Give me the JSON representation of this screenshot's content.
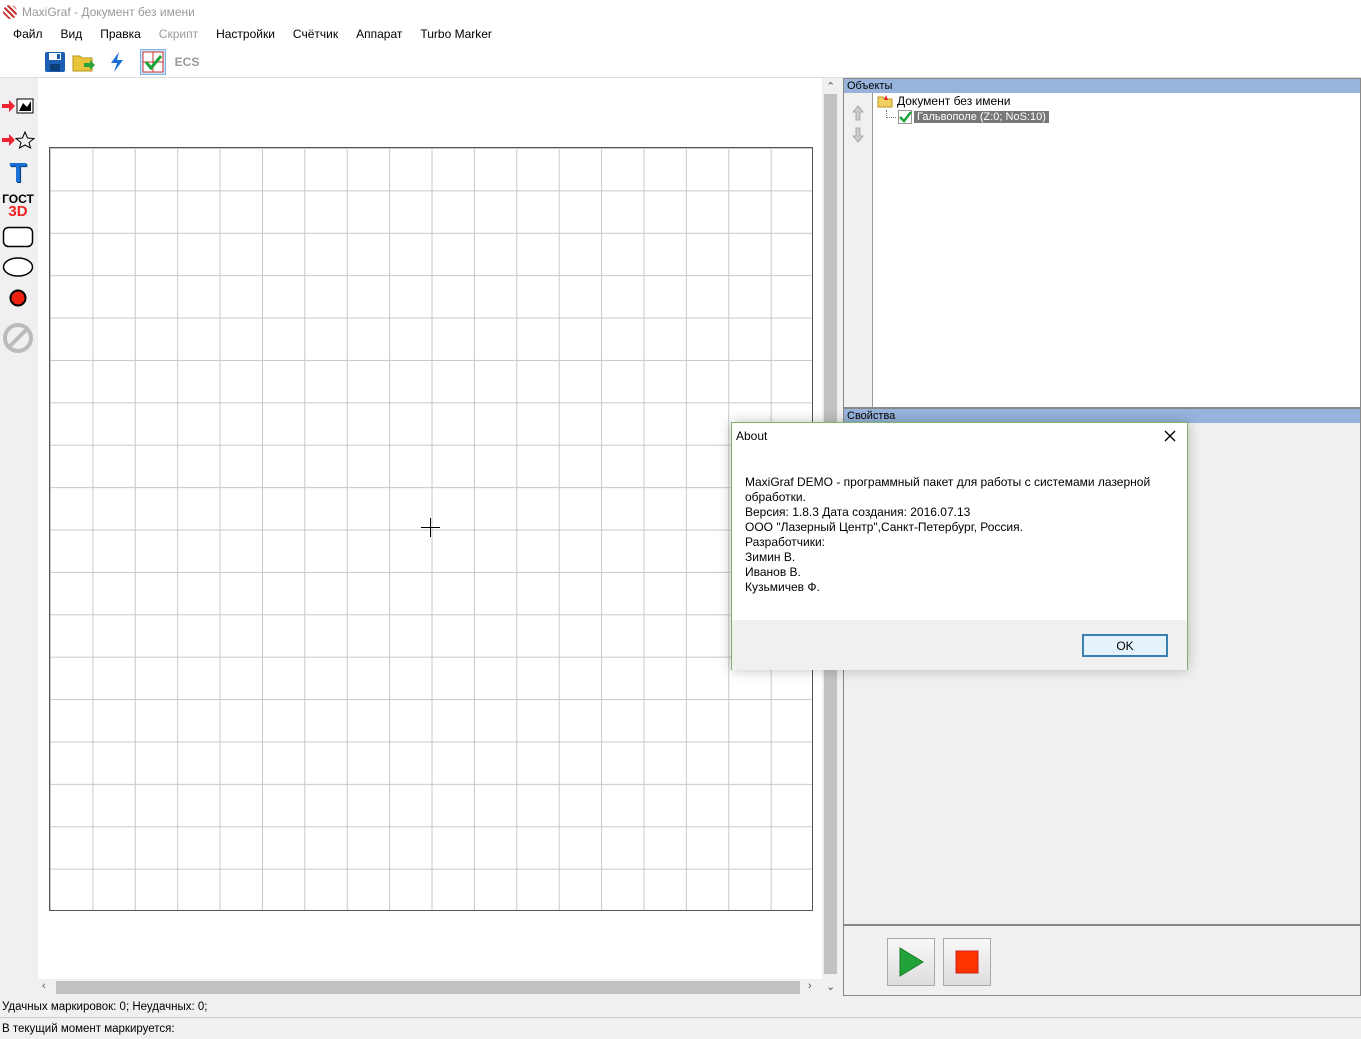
{
  "window": {
    "title": "MaxiGraf - Документ без имени"
  },
  "menu": [
    {
      "label": "Файл",
      "enabled": true
    },
    {
      "label": "Вид",
      "enabled": true
    },
    {
      "label": "Правка",
      "enabled": true
    },
    {
      "label": "Скрипт",
      "enabled": false
    },
    {
      "label": "Настройки",
      "enabled": true
    },
    {
      "label": "Счётчик",
      "enabled": true
    },
    {
      "label": "Аппарат",
      "enabled": true
    },
    {
      "label": "Turbo Marker",
      "enabled": true
    }
  ],
  "toolbar": {
    "icons": [
      "save-icon",
      "open-folder-icon",
      "lightning-icon",
      "checkbox-grid-icon",
      "ecs-icon"
    ],
    "ecs_label": "ECS"
  },
  "left_tools": {
    "gost_text": "ГОСТ",
    "gost_3d": "3D",
    "text_tool": "T"
  },
  "objects_panel": {
    "header": "Объекты",
    "root": "Документ без имени",
    "child": "Гальвополе (Z:0; NoS:10)"
  },
  "properties_panel": {
    "header": "Свойства"
  },
  "dialog": {
    "title": "About",
    "lines": [
      "MaxiGraf DEMO - программный пакет для работы с системами лазерной обработки.",
      "Версия: 1.8.3 Дата создания: 2016.07.13",
      "ООО \"Лазерный Центр\",Санкт-Петербург, Россия.",
      "Разработчики:",
      "Зимин В.",
      "Иванов В.",
      "Кузьмичев Ф."
    ],
    "ok_label": "OK"
  },
  "status": {
    "line1": "Удачных маркировок: 0; Неудачных: 0;",
    "line2": "В текущий момент маркируется:"
  },
  "colors": {
    "accent": "#3c7fb1",
    "panel_header": "#98b4dc",
    "play": "#22a33a",
    "stop": "#ff3300"
  }
}
